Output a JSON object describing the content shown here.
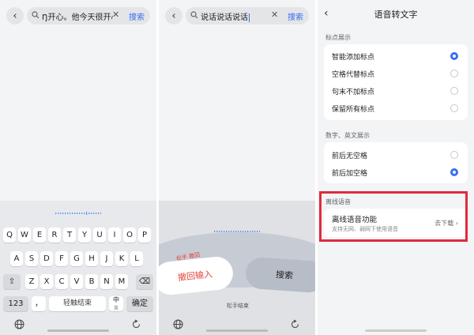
{
  "panel1": {
    "search_text": "Ŋ开心。他今天很开心",
    "search_button": "搜索",
    "keyboard": {
      "row1": [
        "Q",
        "W",
        "E",
        "R",
        "T",
        "Y",
        "U",
        "I",
        "O",
        "P"
      ],
      "row2": [
        "A",
        "S",
        "D",
        "F",
        "G",
        "H",
        "J",
        "K",
        "L"
      ],
      "row3": [
        "Z",
        "X",
        "C",
        "V",
        "B",
        "N",
        "M"
      ],
      "key_123": "123",
      "key_punct": "，",
      "key_space": "轻触结束",
      "key_lang": "中",
      "key_lang_sub": "英",
      "key_confirm": "确定"
    }
  },
  "panel2": {
    "search_text": "说话说话说话",
    "search_button": "搜索",
    "hint_small": "松手 撤回",
    "undo_label": "撤回输入",
    "search_label": "搜索",
    "release_hint": "松手结束"
  },
  "panel3": {
    "title": "语音转文字",
    "section_punct": "标点展示",
    "punct_options": [
      {
        "label": "智能添加标点",
        "selected": true
      },
      {
        "label": "空格代替标点",
        "selected": false
      },
      {
        "label": "句末不加标点",
        "selected": false
      },
      {
        "label": "保留所有标点",
        "selected": false
      }
    ],
    "section_num": "数字、英文展示",
    "num_options": [
      {
        "label": "前后无空格",
        "selected": false
      },
      {
        "label": "前后加空格",
        "selected": true
      }
    ],
    "section_offline": "离线语音",
    "offline_title": "离线语音功能",
    "offline_sub": "支持无网、弱网下使用语音",
    "offline_action": "去下载"
  },
  "colors": {
    "accent": "#3a6df0",
    "highlight_border": "#e02a3c",
    "undo_red": "#e0463c"
  }
}
